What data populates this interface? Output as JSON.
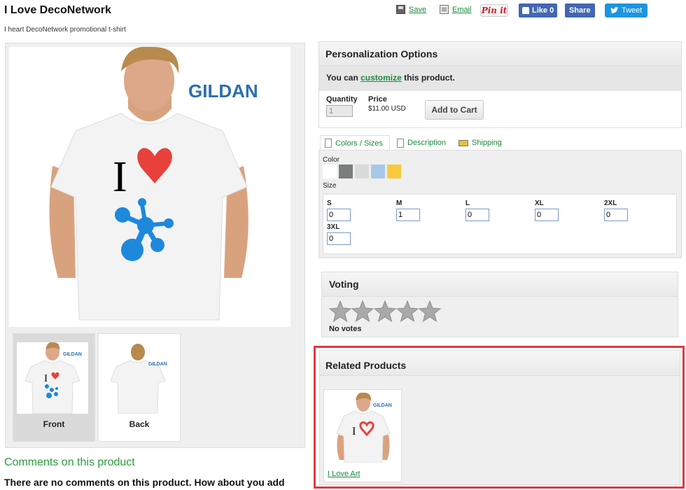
{
  "header": {
    "title": "I Love DecoNetwork",
    "subtitle": "I heart DecoNetwork promotional t-shirt",
    "save_label": "Save",
    "email_label": "Email",
    "pinit_label": "Pin it",
    "fb_like_label": "Like 0",
    "fb_share_label": "Share",
    "tweet_label": "Tweet"
  },
  "gallery": {
    "brand_text": "GILDAN",
    "shirt_text": "I",
    "thumbnails": [
      {
        "label": "Front"
      },
      {
        "label": "Back"
      }
    ]
  },
  "personalization": {
    "title": "Personalization Options",
    "msg_prefix": "You can ",
    "msg_link": "customize",
    "msg_suffix": " this product.",
    "quantity_label": "Quantity",
    "quantity_value": "1",
    "price_label": "Price",
    "price_value": "$11.00 USD",
    "add_to_cart": "Add to Cart"
  },
  "tabs": [
    {
      "label": "Colors / Sizes"
    },
    {
      "label": "Description"
    },
    {
      "label": "Shipping"
    }
  ],
  "options": {
    "color_label": "Color",
    "colors": [
      "#ffffff",
      "#7a7e7f",
      "#d6dcd9",
      "#a8c8ea",
      "#f8ca3a"
    ],
    "size_label": "Size",
    "sizes": [
      {
        "name": "S",
        "value": "0"
      },
      {
        "name": "M",
        "value": "1"
      },
      {
        "name": "L",
        "value": "0"
      },
      {
        "name": "XL",
        "value": "0"
      },
      {
        "name": "2XL",
        "value": "0"
      },
      {
        "name": "3XL",
        "value": "0"
      }
    ]
  },
  "voting": {
    "title": "Voting",
    "rating": 0,
    "max_stars": 5,
    "status": "No votes"
  },
  "related": {
    "title": "Related Products",
    "items": [
      {
        "name": "I Love Art"
      }
    ]
  },
  "comments": {
    "title": "Comments on this product",
    "text": "There are no comments on this product. How about you add"
  },
  "colors": {
    "link_green": "#1a8c3a",
    "highlight_red": "#e0393e",
    "facebook_blue": "#4267b2",
    "twitter_blue": "#1b95e0"
  }
}
